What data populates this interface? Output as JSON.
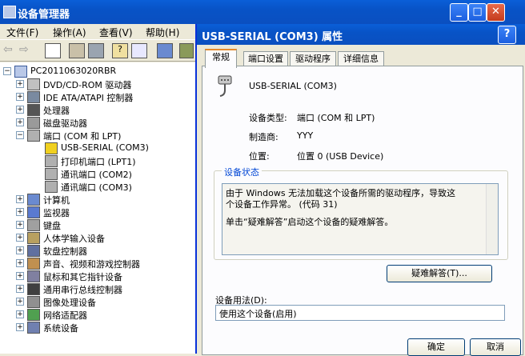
{
  "dm": {
    "title": "设备管理器",
    "menu": [
      "文件(F)",
      "操作(A)",
      "查看(V)",
      "帮助(H)"
    ]
  },
  "tree": {
    "root": "PC2011063020RBR",
    "items": [
      {
        "label": "DVD/CD-ROM 驱动器",
        "icon": "cdrom-icon",
        "level": 1,
        "expanded": false
      },
      {
        "label": "IDE ATA/ATAPI 控制器",
        "icon": "ide-controller-icon",
        "level": 1,
        "expanded": false
      },
      {
        "label": "处理器",
        "icon": "processor-icon",
        "level": 1,
        "expanded": false
      },
      {
        "label": "磁盘驱动器",
        "icon": "disk-drive-icon",
        "level": 1,
        "expanded": false
      },
      {
        "label": "端口 (COM 和 LPT)",
        "icon": "port-icon",
        "level": 1,
        "expanded": true
      },
      {
        "label": "USB-SERIAL (COM3)",
        "icon": "warning-port-icon",
        "level": 2
      },
      {
        "label": "打印机端口 (LPT1)",
        "icon": "port-icon",
        "level": 2
      },
      {
        "label": "通讯端口 (COM2)",
        "icon": "port-icon",
        "level": 2
      },
      {
        "label": "通讯端口 (COM3)",
        "icon": "port-icon",
        "level": 2
      },
      {
        "label": "计算机",
        "icon": "computer-icon",
        "level": 1,
        "expanded": false
      },
      {
        "label": "监视器",
        "icon": "monitor-icon",
        "level": 1,
        "expanded": false
      },
      {
        "label": "键盘",
        "icon": "keyboard-icon",
        "level": 1,
        "expanded": false
      },
      {
        "label": "人体学输入设备",
        "icon": "hid-icon",
        "level": 1,
        "expanded": false
      },
      {
        "label": "软盘控制器",
        "icon": "floppy-controller-icon",
        "level": 1,
        "expanded": false
      },
      {
        "label": "声音、视频和游戏控制器",
        "icon": "sound-icon",
        "level": 1,
        "expanded": false
      },
      {
        "label": "鼠标和其它指针设备",
        "icon": "mouse-icon",
        "level": 1,
        "expanded": false
      },
      {
        "label": "通用串行总线控制器",
        "icon": "usb-icon",
        "level": 1,
        "expanded": false
      },
      {
        "label": "图像处理设备",
        "icon": "imaging-icon",
        "level": 1,
        "expanded": false
      },
      {
        "label": "网络适配器",
        "icon": "network-icon",
        "level": 1,
        "expanded": false
      },
      {
        "label": "系统设备",
        "icon": "system-icon",
        "level": 1,
        "expanded": false
      }
    ]
  },
  "dialog": {
    "title": "USB-SERIAL (COM3) 属性",
    "tabs": [
      "常规",
      "端口设置",
      "驱动程序",
      "详细信息"
    ],
    "device_name": "USB-SERIAL (COM3)",
    "type_label": "设备类型:",
    "type_value": "端口 (COM 和 LPT)",
    "maker_label": "制造商:",
    "maker_value": "YYY",
    "location_label": "位置:",
    "location_value": "位置 0 (USB Device)",
    "status_legend": "设备状态",
    "status_line1": "由于 Windows 无法加载这个设备所需的驱动程序，导致这",
    "status_line2": "个设备工作异常。 (代码 31)",
    "status_line3": "单击“疑难解答”启动这个设备的疑难解答。",
    "troubleshoot_button": "疑难解答(T)...",
    "usage_label": "设备用法(D):",
    "usage_value": "使用这个设备(启用)",
    "ok_button": "确定",
    "cancel_button": "取消"
  }
}
